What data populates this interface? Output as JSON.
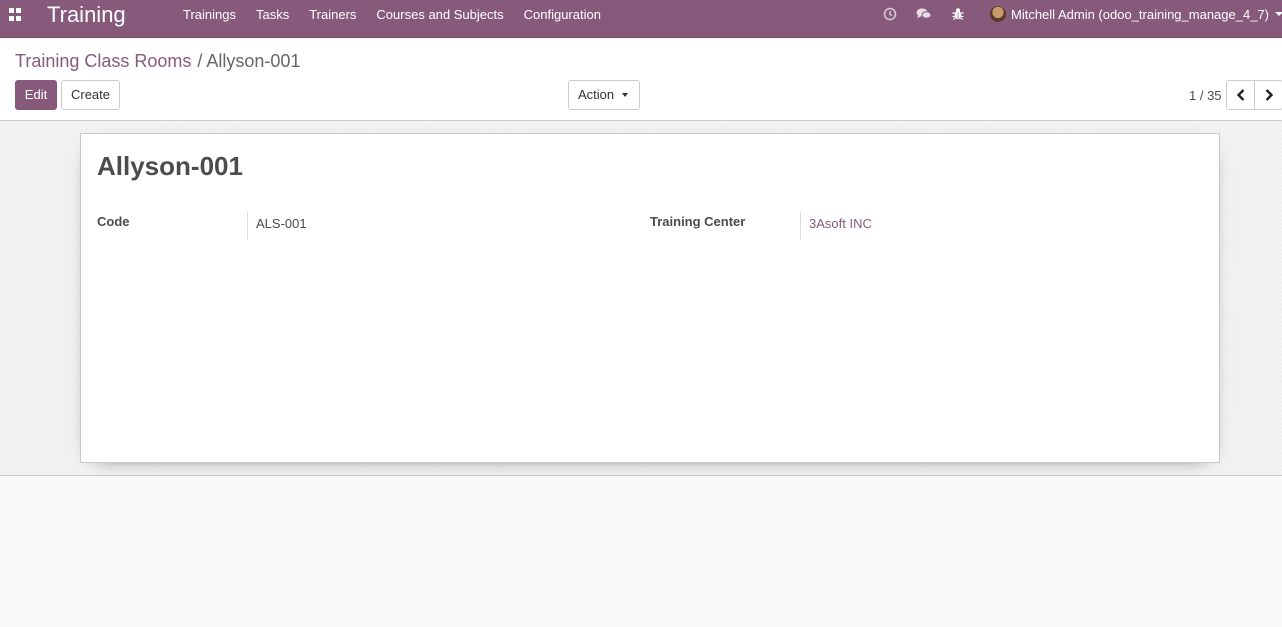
{
  "navbar": {
    "brand": "Training",
    "menu": [
      "Trainings",
      "Tasks",
      "Trainers",
      "Courses and Subjects",
      "Configuration"
    ],
    "user": "Mitchell Admin (odoo_training_manage_4_7)",
    "icons": [
      "clock-icon",
      "chat-icon",
      "bug-icon"
    ]
  },
  "breadcrumb": {
    "parent": "Training Class Rooms",
    "separator": "/",
    "current": "Allyson-001"
  },
  "buttons": {
    "edit": "Edit",
    "create": "Create",
    "action": "Action"
  },
  "pager": {
    "value": "1 / 35"
  },
  "record": {
    "title": "Allyson-001",
    "fields": {
      "code_label": "Code",
      "code_value": "ALS-001",
      "center_label": "Training Center",
      "center_value": "3Asoft INC"
    }
  },
  "colors": {
    "brand": "#875a7b",
    "link": "#875a7b"
  }
}
